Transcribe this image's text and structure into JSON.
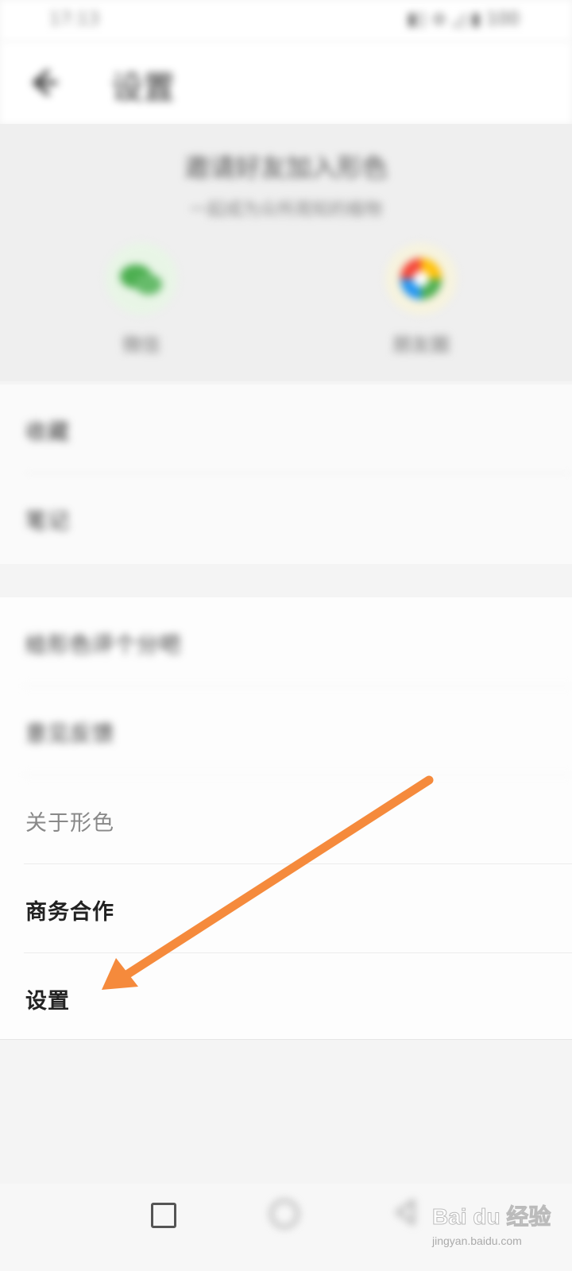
{
  "status_bar": {
    "time": "17:13",
    "right_text": "▮▯ ⊚ ◿ ▮ 100"
  },
  "header": {
    "title": "设置"
  },
  "share_panel": {
    "title": "邀请好友加入形色",
    "subtitle": "一起成为众所周知的植物",
    "options": [
      {
        "label": "微信",
        "icon": "wechat-icon"
      },
      {
        "label": "朋友圈",
        "icon": "moments-icon"
      }
    ]
  },
  "menu_group_1": [
    {
      "label": "收藏"
    },
    {
      "label": "笔记"
    }
  ],
  "menu_group_2": [
    {
      "label": "给形色评个分吧"
    },
    {
      "label": "意见反馈"
    },
    {
      "label": "关于形色"
    },
    {
      "label": "商务合作"
    },
    {
      "label": "设置"
    }
  ],
  "annotation": {
    "arrow_color": "#f58a3c"
  },
  "watermark": {
    "text": "Bai du 经验",
    "url": "jingyan.baidu.com"
  },
  "colors": {
    "accent_arrow": "#f58a3c",
    "wechat_green": "#4caf50"
  }
}
